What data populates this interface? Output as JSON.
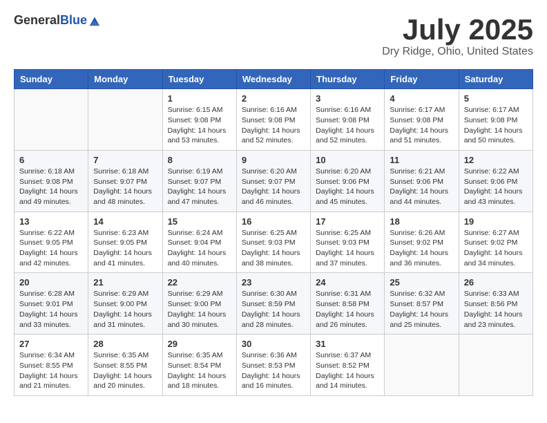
{
  "logo": {
    "general": "General",
    "blue": "Blue"
  },
  "header": {
    "title": "July 2025",
    "subtitle": "Dry Ridge, Ohio, United States"
  },
  "days_of_week": [
    "Sunday",
    "Monday",
    "Tuesday",
    "Wednesday",
    "Thursday",
    "Friday",
    "Saturday"
  ],
  "weeks": [
    [
      {
        "day": "",
        "empty": true
      },
      {
        "day": "",
        "empty": true
      },
      {
        "day": "1",
        "sunrise": "6:15 AM",
        "sunset": "9:08 PM",
        "daylight": "14 hours and 53 minutes."
      },
      {
        "day": "2",
        "sunrise": "6:16 AM",
        "sunset": "9:08 PM",
        "daylight": "14 hours and 52 minutes."
      },
      {
        "day": "3",
        "sunrise": "6:16 AM",
        "sunset": "9:08 PM",
        "daylight": "14 hours and 52 minutes."
      },
      {
        "day": "4",
        "sunrise": "6:17 AM",
        "sunset": "9:08 PM",
        "daylight": "14 hours and 51 minutes."
      },
      {
        "day": "5",
        "sunrise": "6:17 AM",
        "sunset": "9:08 PM",
        "daylight": "14 hours and 50 minutes."
      }
    ],
    [
      {
        "day": "6",
        "sunrise": "6:18 AM",
        "sunset": "9:08 PM",
        "daylight": "14 hours and 49 minutes."
      },
      {
        "day": "7",
        "sunrise": "6:18 AM",
        "sunset": "9:07 PM",
        "daylight": "14 hours and 48 minutes."
      },
      {
        "day": "8",
        "sunrise": "6:19 AM",
        "sunset": "9:07 PM",
        "daylight": "14 hours and 47 minutes."
      },
      {
        "day": "9",
        "sunrise": "6:20 AM",
        "sunset": "9:07 PM",
        "daylight": "14 hours and 46 minutes."
      },
      {
        "day": "10",
        "sunrise": "6:20 AM",
        "sunset": "9:06 PM",
        "daylight": "14 hours and 45 minutes."
      },
      {
        "day": "11",
        "sunrise": "6:21 AM",
        "sunset": "9:06 PM",
        "daylight": "14 hours and 44 minutes."
      },
      {
        "day": "12",
        "sunrise": "6:22 AM",
        "sunset": "9:06 PM",
        "daylight": "14 hours and 43 minutes."
      }
    ],
    [
      {
        "day": "13",
        "sunrise": "6:22 AM",
        "sunset": "9:05 PM",
        "daylight": "14 hours and 42 minutes."
      },
      {
        "day": "14",
        "sunrise": "6:23 AM",
        "sunset": "9:05 PM",
        "daylight": "14 hours and 41 minutes."
      },
      {
        "day": "15",
        "sunrise": "6:24 AM",
        "sunset": "9:04 PM",
        "daylight": "14 hours and 40 minutes."
      },
      {
        "day": "16",
        "sunrise": "6:25 AM",
        "sunset": "9:03 PM",
        "daylight": "14 hours and 38 minutes."
      },
      {
        "day": "17",
        "sunrise": "6:25 AM",
        "sunset": "9:03 PM",
        "daylight": "14 hours and 37 minutes."
      },
      {
        "day": "18",
        "sunrise": "6:26 AM",
        "sunset": "9:02 PM",
        "daylight": "14 hours and 36 minutes."
      },
      {
        "day": "19",
        "sunrise": "6:27 AM",
        "sunset": "9:02 PM",
        "daylight": "14 hours and 34 minutes."
      }
    ],
    [
      {
        "day": "20",
        "sunrise": "6:28 AM",
        "sunset": "9:01 PM",
        "daylight": "14 hours and 33 minutes."
      },
      {
        "day": "21",
        "sunrise": "6:29 AM",
        "sunset": "9:00 PM",
        "daylight": "14 hours and 31 minutes."
      },
      {
        "day": "22",
        "sunrise": "6:29 AM",
        "sunset": "9:00 PM",
        "daylight": "14 hours and 30 minutes."
      },
      {
        "day": "23",
        "sunrise": "6:30 AM",
        "sunset": "8:59 PM",
        "daylight": "14 hours and 28 minutes."
      },
      {
        "day": "24",
        "sunrise": "6:31 AM",
        "sunset": "8:58 PM",
        "daylight": "14 hours and 26 minutes."
      },
      {
        "day": "25",
        "sunrise": "6:32 AM",
        "sunset": "8:57 PM",
        "daylight": "14 hours and 25 minutes."
      },
      {
        "day": "26",
        "sunrise": "6:33 AM",
        "sunset": "8:56 PM",
        "daylight": "14 hours and 23 minutes."
      }
    ],
    [
      {
        "day": "27",
        "sunrise": "6:34 AM",
        "sunset": "8:55 PM",
        "daylight": "14 hours and 21 minutes."
      },
      {
        "day": "28",
        "sunrise": "6:35 AM",
        "sunset": "8:55 PM",
        "daylight": "14 hours and 20 minutes."
      },
      {
        "day": "29",
        "sunrise": "6:35 AM",
        "sunset": "8:54 PM",
        "daylight": "14 hours and 18 minutes."
      },
      {
        "day": "30",
        "sunrise": "6:36 AM",
        "sunset": "8:53 PM",
        "daylight": "14 hours and 16 minutes."
      },
      {
        "day": "31",
        "sunrise": "6:37 AM",
        "sunset": "8:52 PM",
        "daylight": "14 hours and 14 minutes."
      },
      {
        "day": "",
        "empty": true
      },
      {
        "day": "",
        "empty": true
      }
    ]
  ]
}
